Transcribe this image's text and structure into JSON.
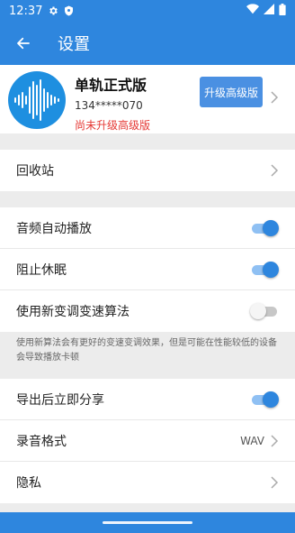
{
  "status_bar": {
    "time": "12:37"
  },
  "app_bar": {
    "title": "设置"
  },
  "profile": {
    "name": "单轨正式版",
    "phone": "134*****070",
    "status": "尚未升级高级版",
    "upgrade_label": "升级高级版"
  },
  "recycle": {
    "label": "回收站"
  },
  "playback": [
    {
      "label": "音频自动播放",
      "on": true
    },
    {
      "label": "阻止休眠",
      "on": true
    },
    {
      "label": "使用新变调变速算法",
      "on": false
    }
  ],
  "note": "使用新算法会有更好的变速变调效果，但是可能在性能较低的设备会导致播放卡顿",
  "export_share": {
    "label": "导出后立即分享",
    "on": true
  },
  "record_format": {
    "label": "录音格式",
    "value": "WAV"
  },
  "privacy": {
    "label": "隐私"
  },
  "colors": {
    "primary": "#2e86de",
    "warning": "#e53935"
  }
}
